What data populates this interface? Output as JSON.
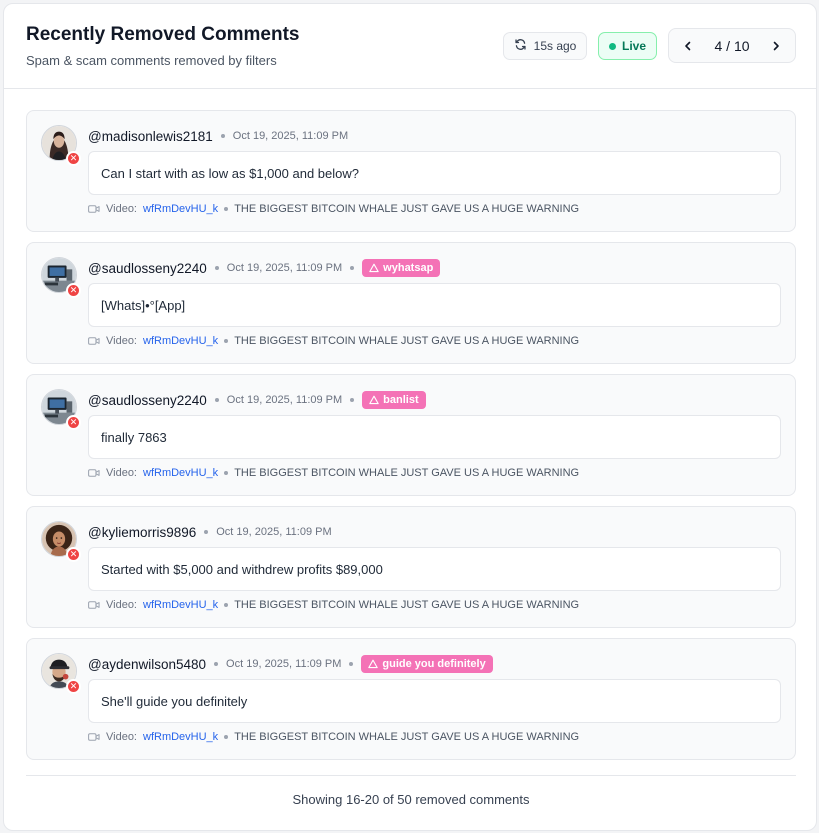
{
  "header": {
    "title": "Recently Removed Comments",
    "subtitle": "Spam & scam comments removed by filters",
    "refresh_label": "15s ago",
    "live_label": "Live",
    "page_indicator": "4 / 10"
  },
  "comments": [
    {
      "username": "@madisonlewis2181",
      "time": "Oct 19, 2025, 11:09 PM",
      "tag": "",
      "text": "Can I start with as low as $1,000 and below?",
      "video_label": "Video:",
      "video_id": "wfRmDevHU_k",
      "video_title": "THE BIGGEST BITCOIN WHALE JUST GAVE US A HUGE WARNING",
      "avatar": "woman-dark-hair-avatar"
    },
    {
      "username": "@saudlosseny2240",
      "time": "Oct 19, 2025, 11:09 PM",
      "tag": "wyhatsap",
      "text": "[Whats]•°[App]",
      "video_label": "Video:",
      "video_id": "wfRmDevHU_k",
      "video_title": "THE BIGGEST BITCOIN WHALE JUST GAVE US A HUGE WARNING",
      "avatar": "desk-monitor-avatar"
    },
    {
      "username": "@saudlosseny2240",
      "time": "Oct 19, 2025, 11:09 PM",
      "tag": "banlist",
      "text": "finally 7863",
      "video_label": "Video:",
      "video_id": "wfRmDevHU_k",
      "video_title": "THE BIGGEST BITCOIN WHALE JUST GAVE US A HUGE WARNING",
      "avatar": "desk-monitor-avatar"
    },
    {
      "username": "@kyliemorris9896",
      "time": "Oct 19, 2025, 11:09 PM",
      "tag": "",
      "text": "Started with $5,000 and withdrew profits $89,000",
      "video_label": "Video:",
      "video_id": "wfRmDevHU_k",
      "video_title": "THE BIGGEST BITCOIN WHALE JUST GAVE US A HUGE WARNING",
      "avatar": "woman-curly-hair-avatar"
    },
    {
      "username": "@aydenwilson5480",
      "time": "Oct 19, 2025, 11:09 PM",
      "tag": "guide you definitely",
      "text": "She'll guide you definitely",
      "video_label": "Video:",
      "video_id": "wfRmDevHU_k",
      "video_title": "THE BIGGEST BITCOIN WHALE JUST GAVE US A HUGE WARNING",
      "avatar": "man-cap-avatar"
    }
  ],
  "footer": {
    "summary": "Showing 16-20 of 50 removed comments"
  },
  "colors": {
    "tag_bg": "#f472b6",
    "removed_badge": "#ef4444",
    "live_green": "#10b981",
    "link_blue": "#2563eb"
  }
}
